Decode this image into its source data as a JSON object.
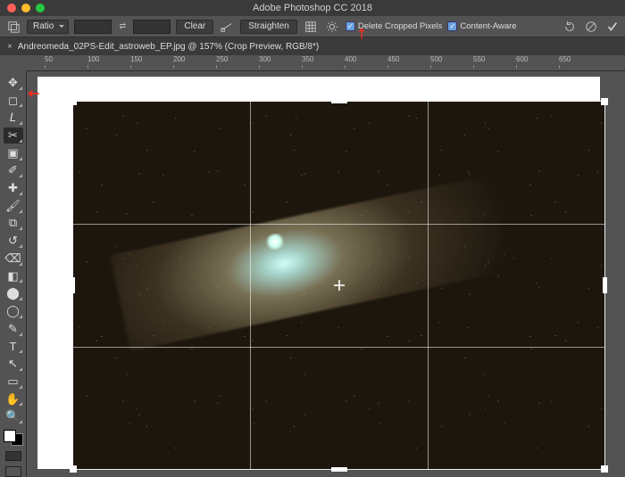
{
  "titlebar": {
    "title": "Adobe Photoshop CC 2018"
  },
  "optbar": {
    "ratio_label": "Ratio",
    "clear_label": "Clear",
    "straighten_label": "Straighten",
    "delete_cropped_label": "Delete Cropped Pixels",
    "content_aware_label": "Content-Aware"
  },
  "doc": {
    "tab_label": "Andreomeda_02PS-Edit_astroweb_EP.jpg @ 157% (Crop Preview, RGB/8*)"
  },
  "ruler": {
    "ticks": [
      "50",
      "100",
      "150",
      "200",
      "250",
      "300",
      "350",
      "400",
      "450",
      "500",
      "550",
      "600",
      "650"
    ]
  },
  "tools": [
    {
      "name": "move-tool",
      "glyph": "✥"
    },
    {
      "name": "marquee-tool",
      "glyph": "◻"
    },
    {
      "name": "lasso-tool",
      "glyph": "𝘓"
    },
    {
      "name": "crop-tool",
      "glyph": "✂",
      "active": true
    },
    {
      "name": "frame-tool",
      "glyph": "▣"
    },
    {
      "name": "eyedropper-tool",
      "glyph": "✐"
    },
    {
      "name": "healing-brush-tool",
      "glyph": "✚"
    },
    {
      "name": "brush-tool",
      "glyph": "🖌"
    },
    {
      "name": "clone-stamp-tool",
      "glyph": "⧉"
    },
    {
      "name": "history-brush-tool",
      "glyph": "↺"
    },
    {
      "name": "eraser-tool",
      "glyph": "⌫"
    },
    {
      "name": "gradient-tool",
      "glyph": "◧"
    },
    {
      "name": "blur-tool",
      "glyph": "⬤"
    },
    {
      "name": "dodge-tool",
      "glyph": "◯"
    },
    {
      "name": "pen-tool",
      "glyph": "✎"
    },
    {
      "name": "type-tool",
      "glyph": "T"
    },
    {
      "name": "path-select-tool",
      "glyph": "↖"
    },
    {
      "name": "shape-tool",
      "glyph": "▭"
    },
    {
      "name": "hand-tool",
      "glyph": "✋"
    },
    {
      "name": "zoom-tool",
      "glyph": "🔍"
    }
  ]
}
